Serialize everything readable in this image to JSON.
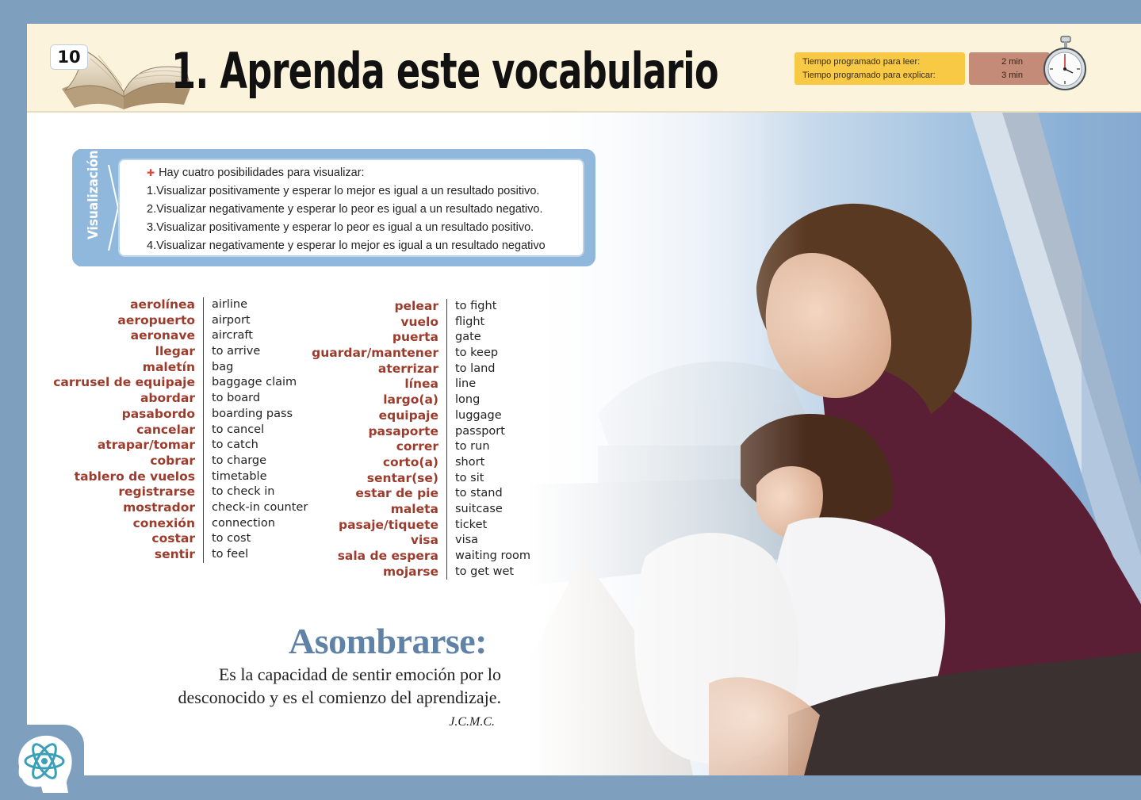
{
  "header": {
    "page_number": "10",
    "title": "1. Aprenda este vocabulario",
    "time_read_label": "Tiempo programado para leer:",
    "time_explain_label": "Tiempo programado para explicar:",
    "time_read_value": "2 min",
    "time_explain_value": "3 min",
    "icons": [
      "open-book-icon",
      "stopwatch-icon"
    ]
  },
  "visualizacion": {
    "label": "Visualización",
    "intro": "Hay cuatro posibilidades para visualizar:",
    "items": [
      "1.Visualizar positivamente y esperar lo mejor es igual a un resultado positivo.",
      "2.Visualizar negativamente y esperar lo peor es igual a un resultado negativo.",
      "3.Visualizar positivamente y esperar lo peor es igual a un resultado positivo.",
      "4.Visualizar negativamente y esperar lo mejor es igual a un resultado negativo"
    ]
  },
  "vocab_left": [
    {
      "es": "aerolínea",
      "en": "airline"
    },
    {
      "es": "aeropuerto",
      "en": "airport"
    },
    {
      "es": "aeronave",
      "en": "aircraft"
    },
    {
      "es": "llegar",
      "en": "to arrive"
    },
    {
      "es": "maletín",
      "en": "bag"
    },
    {
      "es": "carrusel de equipaje",
      "en": "baggage claim"
    },
    {
      "es": "abordar",
      "en": "to board"
    },
    {
      "es": "pasabordo",
      "en": "boarding pass"
    },
    {
      "es": "cancelar",
      "en": "to cancel"
    },
    {
      "es": "atrapar/tomar",
      "en": "to catch"
    },
    {
      "es": "cobrar",
      "en": "to charge"
    },
    {
      "es": "tablero de vuelos",
      "en": "timetable"
    },
    {
      "es": "registrarse",
      "en": "to check in"
    },
    {
      "es": "mostrador",
      "en": "check-in counter"
    },
    {
      "es": "conexión",
      "en": "connection"
    },
    {
      "es": "costar",
      "en": "to cost"
    },
    {
      "es": "sentir",
      "en": "to feel"
    }
  ],
  "vocab_right": [
    {
      "es": "pelear",
      "en": "to fight"
    },
    {
      "es": "vuelo",
      "en": "flight"
    },
    {
      "es": "puerta",
      "en": "gate"
    },
    {
      "es": "guardar/mantener",
      "en": "to keep"
    },
    {
      "es": "aterrizar",
      "en": "to land"
    },
    {
      "es": "línea",
      "en": "line"
    },
    {
      "es": "largo(a)",
      "en": "long"
    },
    {
      "es": "equipaje",
      "en": "luggage"
    },
    {
      "es": "pasaporte",
      "en": "passport"
    },
    {
      "es": "correr",
      "en": "to run"
    },
    {
      "es": "corto(a)",
      "en": "short"
    },
    {
      "es": "sentar(se)",
      "en": "to sit"
    },
    {
      "es": "estar de pie",
      "en": "to stand"
    },
    {
      "es": "maleta",
      "en": "suitcase"
    },
    {
      "es": "pasaje/tiquete",
      "en": "ticket"
    },
    {
      "es": "visa",
      "en": "visa"
    },
    {
      "es": "sala de espera",
      "en": "waiting room"
    },
    {
      "es": "mojarse",
      "en": "to get wet"
    }
  ],
  "quote": {
    "title": "Asombrarse:",
    "line1": "Es la capacidad de sentir emoción por lo",
    "line2": "desconocido y es el comienzo del aprendizaje.",
    "author": "J.C.M.C."
  },
  "footer": {
    "logo_icon": "atom-head-icon"
  }
}
